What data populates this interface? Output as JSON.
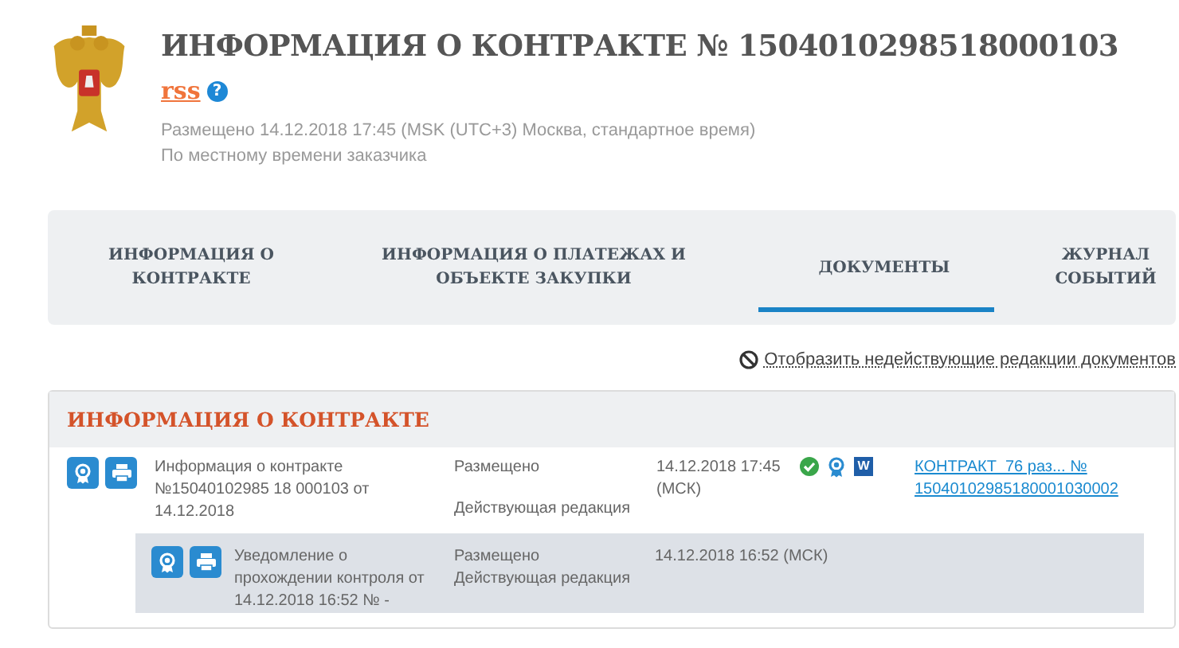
{
  "header": {
    "title": "ИНФОРМАЦИЯ О КОНТРАКТЕ № 1504010298518000103",
    "rss": "rss",
    "help": "?",
    "posted": "Размещено 14.12.2018 17:45 (MSK (UTC+3) Москва, стандартное время)",
    "local_time": "По местному времени заказчика"
  },
  "tabs": [
    {
      "label": "ИНФОРМАЦИЯ О КОНТРАКТЕ",
      "selected": false
    },
    {
      "label": "ИНФОРМАЦИЯ О ПЛАТЕЖАХ И ОБЪЕКТЕ ЗАКУПКИ",
      "selected": false
    },
    {
      "label": "ДОКУМЕНТЫ",
      "selected": true
    },
    {
      "label": "ЖУРНАЛ СОБЫТИЙ",
      "selected": false
    }
  ],
  "toggle_link": "Отобразить недействующие редакции документов",
  "section": {
    "title": "ИНФОРМАЦИЯ О КОНТРАКТЕ",
    "documents": [
      {
        "name": "Информация о контракте №15040102985 18 000103 от 14.12.2018",
        "status": "Размещено",
        "edition": "Действующая редакция",
        "date": "14.12.2018 17:45 (МСК)",
        "signed": true,
        "word_icon": "W",
        "file": "КОНТРАКТ_76 раз... № 15040102985180001030002",
        "children": [
          {
            "name": "Уведомление о прохождении контроля от 14.12.2018 16:52 № -",
            "status": "Размещено",
            "edition": "Действующая редакция",
            "date": "14.12.2018 16:52 (МСК)",
            "signed": false
          }
        ]
      }
    ]
  }
}
